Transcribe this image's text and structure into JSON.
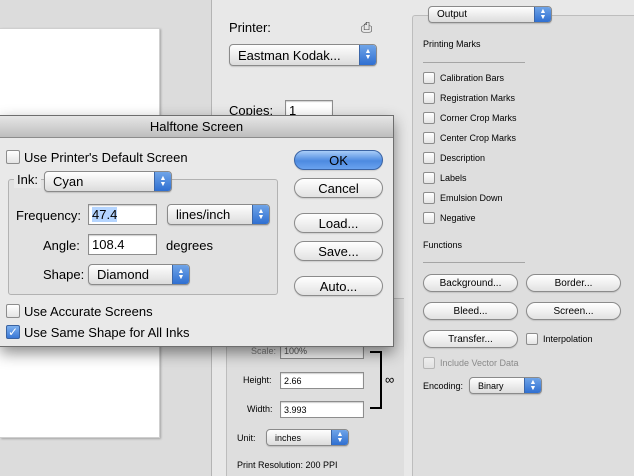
{
  "print_dialog": {
    "printer_label": "Printer:",
    "printer_value": "Eastman Kodak...",
    "copies_label": "Copies:",
    "copies_value": "1",
    "output_popup": "Output",
    "printing_marks": {
      "title": "Printing Marks",
      "items": [
        {
          "label": "Calibration Bars",
          "checked": false
        },
        {
          "label": "Registration Marks",
          "checked": false
        },
        {
          "label": "Corner Crop Marks",
          "checked": false
        },
        {
          "label": "Center Crop Marks",
          "checked": false
        },
        {
          "label": "Description",
          "checked": false
        },
        {
          "label": "Labels",
          "checked": false
        },
        {
          "label": "Emulsion Down",
          "checked": false
        },
        {
          "label": "Negative",
          "checked": false
        }
      ]
    },
    "functions": {
      "title": "Functions",
      "background_button": "Background...",
      "border_button": "Border...",
      "bleed_button": "Bleed...",
      "screen_button": "Screen...",
      "transfer_button": "Transfer...",
      "interpolation_label": "Interpolation",
      "include_vector_label": "Include Vector Data",
      "encoding_label": "Encoding:",
      "encoding_value": "Binary"
    },
    "scaled_size": {
      "scale_label": "Scale:",
      "scale_value": "100%",
      "height_label": "Height:",
      "height_value": "2.66",
      "width_label": "Width:",
      "width_value": "3.993",
      "unit_label": "Unit:",
      "unit_value": "inches",
      "print_resolution": "Print Resolution: 200 PPI"
    }
  },
  "halftone_dialog": {
    "title": "Halftone Screen",
    "use_printer_default_label": "Use Printer's Default Screen",
    "use_printer_default_checked": false,
    "ink_label": "Ink:",
    "ink_value": "Cyan",
    "frequency_label": "Frequency:",
    "frequency_value": "47.4",
    "frequency_unit": "lines/inch",
    "angle_label": "Angle:",
    "angle_value": "108.4",
    "angle_unit": "degrees",
    "shape_label": "Shape:",
    "shape_value": "Diamond",
    "use_accurate_label": "Use Accurate Screens",
    "use_accurate_checked": false,
    "use_same_shape_label": "Use Same Shape for All Inks",
    "use_same_shape_checked": true,
    "ok_button": "OK",
    "cancel_button": "Cancel",
    "load_button": "Load...",
    "save_button": "Save...",
    "auto_button": "Auto..."
  },
  "colors": {
    "accent_blue": "#3a78d6",
    "dialog_bg": "#e9e9e9"
  }
}
